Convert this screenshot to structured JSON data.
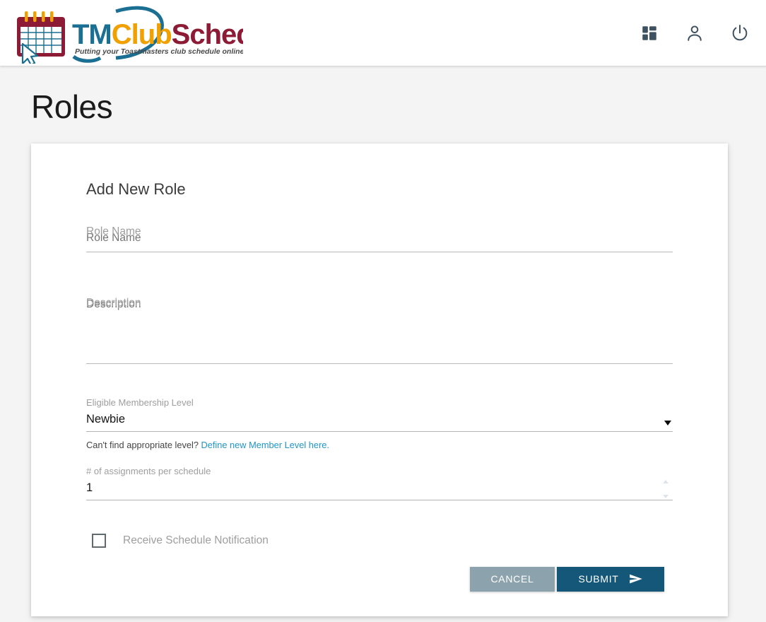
{
  "header": {
    "brand": {
      "name_tm": "TM",
      "name_club": "Club",
      "name_schedule": "Schedule",
      "tagline": "Putting your Toastmasters club schedule online and interactive",
      "logo_icon": "calendar-cursor-logo"
    },
    "actions": [
      {
        "name": "dashboard-icon",
        "label": "Dashboard"
      },
      {
        "name": "account-icon",
        "label": "Account"
      },
      {
        "name": "power-icon",
        "label": "Logout"
      }
    ]
  },
  "page": {
    "title": "Roles"
  },
  "card": {
    "title": "Add New Role"
  },
  "form": {
    "role_name": {
      "label": "Role Name",
      "placeholder": "Role Name",
      "value": ""
    },
    "description": {
      "label": "Description",
      "placeholder": "Description",
      "value": ""
    },
    "membership_level": {
      "label": "Eligible Membership Level",
      "value": "Newbie",
      "options": [
        "Newbie"
      ],
      "arrow_icon": "chevron-down-icon"
    },
    "hint": {
      "text": "Can't find appropriate level?",
      "link_text": "Define new Member Level here.",
      "link_color": "#2196c9"
    },
    "assignments": {
      "label": "# of assignments per schedule",
      "value": "1",
      "spinner_up_icon": "chevron-up-icon",
      "spinner_down_icon": "chevron-down-icon"
    },
    "notification": {
      "label": "Receive Schedule Notification",
      "checked": false
    }
  },
  "buttons": {
    "cancel": {
      "label": "CANCEL",
      "color": "#8ca3ad"
    },
    "submit": {
      "label": "SUBMIT",
      "color": "#155779",
      "icon": "send-icon"
    }
  },
  "theme": {
    "page_background": "#f4f4f4",
    "card_background": "#ffffff",
    "header_background": "#ffffff",
    "icon_color": "#3e5160",
    "brand_tm_color": "#1b6f92",
    "brand_club_color": "#f0a000",
    "brand_schedule_color": "#8e1b36",
    "placeholder_color": "#9e9e9e"
  }
}
